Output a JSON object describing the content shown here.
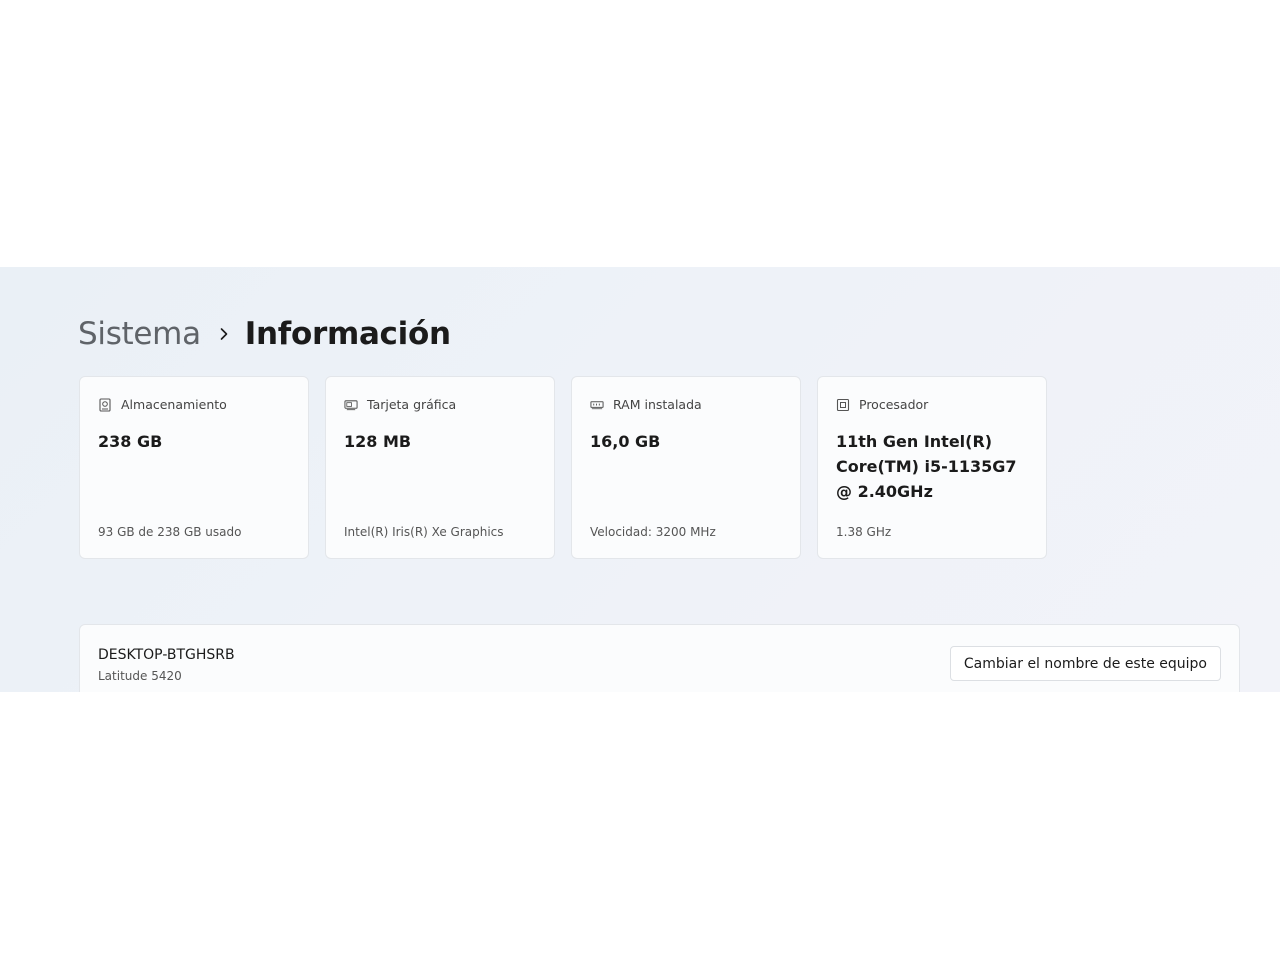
{
  "breadcrumb": {
    "parent": "Sistema",
    "current": "Información"
  },
  "cards": [
    {
      "icon": "storage-icon",
      "label": "Almacenamiento",
      "value": "238 GB",
      "sub": "93 GB de 238 GB usado"
    },
    {
      "icon": "graphics-card-icon",
      "label": "Tarjeta gráfica",
      "value": "128 MB",
      "sub": "Intel(R) Iris(R) Xe Graphics"
    },
    {
      "icon": "ram-icon",
      "label": "RAM instalada",
      "value": "16,0 GB",
      "sub": "Velocidad: 3200 MHz"
    },
    {
      "icon": "processor-icon",
      "label": "Procesador",
      "value": "11th Gen Intel(R) Core(TM) i5-1135G7 @ 2.40GHz",
      "sub": "1.38 GHz"
    }
  ],
  "device": {
    "name": "DESKTOP-BTGHSRB",
    "model": "Latitude 5420",
    "rename_label": "Cambiar el nombre de este equipo"
  },
  "colors": {
    "background": "#eef2f8",
    "card": "#fbfcfd",
    "text_primary": "#1b1b1b",
    "text_secondary": "#5f6368"
  }
}
